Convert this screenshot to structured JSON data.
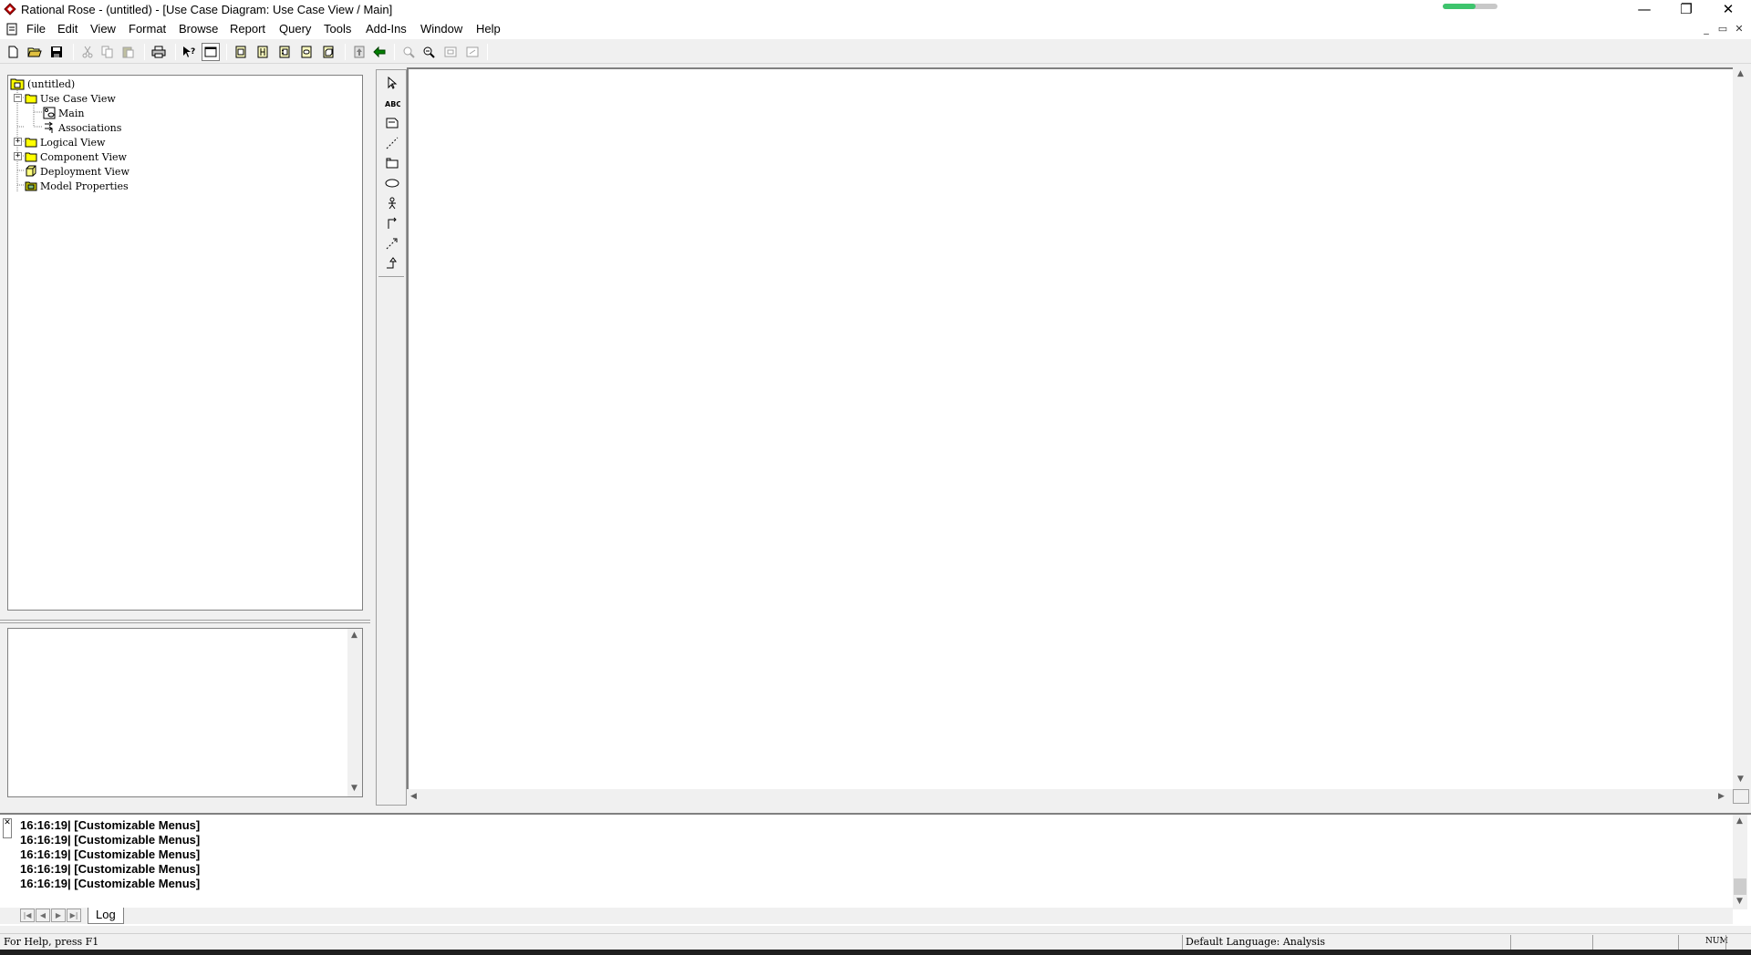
{
  "window": {
    "title": "Rational Rose - (untitled) - [Use Case Diagram: Use Case View / Main]",
    "minimize_glyph": "—",
    "restore_glyph": "❐",
    "close_glyph": "✕"
  },
  "menubar": {
    "items": [
      "File",
      "Edit",
      "View",
      "Format",
      "Browse",
      "Report",
      "Query",
      "Tools",
      "Add-Ins",
      "Window",
      "Help"
    ],
    "mdi_minimize": "_",
    "mdi_restore": "▭",
    "mdi_close": "✕"
  },
  "browser": {
    "tree": [
      {
        "label": "(untitled)",
        "icon": "model-icon",
        "expander": ""
      },
      {
        "label": "Use Case View",
        "icon": "folder-icon",
        "expander": "−"
      },
      {
        "label": "Main",
        "icon": "use-case-diagram-icon",
        "expander": ""
      },
      {
        "label": "Associations",
        "icon": "associations-icon",
        "expander": ""
      },
      {
        "label": "Logical View",
        "icon": "folder-icon",
        "expander": "+"
      },
      {
        "label": "Component View",
        "icon": "folder-icon",
        "expander": "+"
      },
      {
        "label": "Deployment View",
        "icon": "deployment-icon",
        "expander": ""
      },
      {
        "label": "Model Properties",
        "icon": "properties-folder-icon",
        "expander": ""
      }
    ]
  },
  "log": {
    "lines": [
      "16:16:19|  [Customizable Menus]",
      "16:16:19|  [Customizable Menus]",
      "16:16:19|  [Customizable Menus]",
      "16:16:19|  [Customizable Menus]",
      "16:16:19|  [Customizable Menus]"
    ],
    "tab_label": "Log"
  },
  "status": {
    "help_text": "For Help, press F1",
    "language": "Default Language: Analysis",
    "ovr": "NUM"
  },
  "colors": {
    "progress": "#3ec46d",
    "folder": "#ffff00",
    "toolbar_accent": "#008000"
  }
}
